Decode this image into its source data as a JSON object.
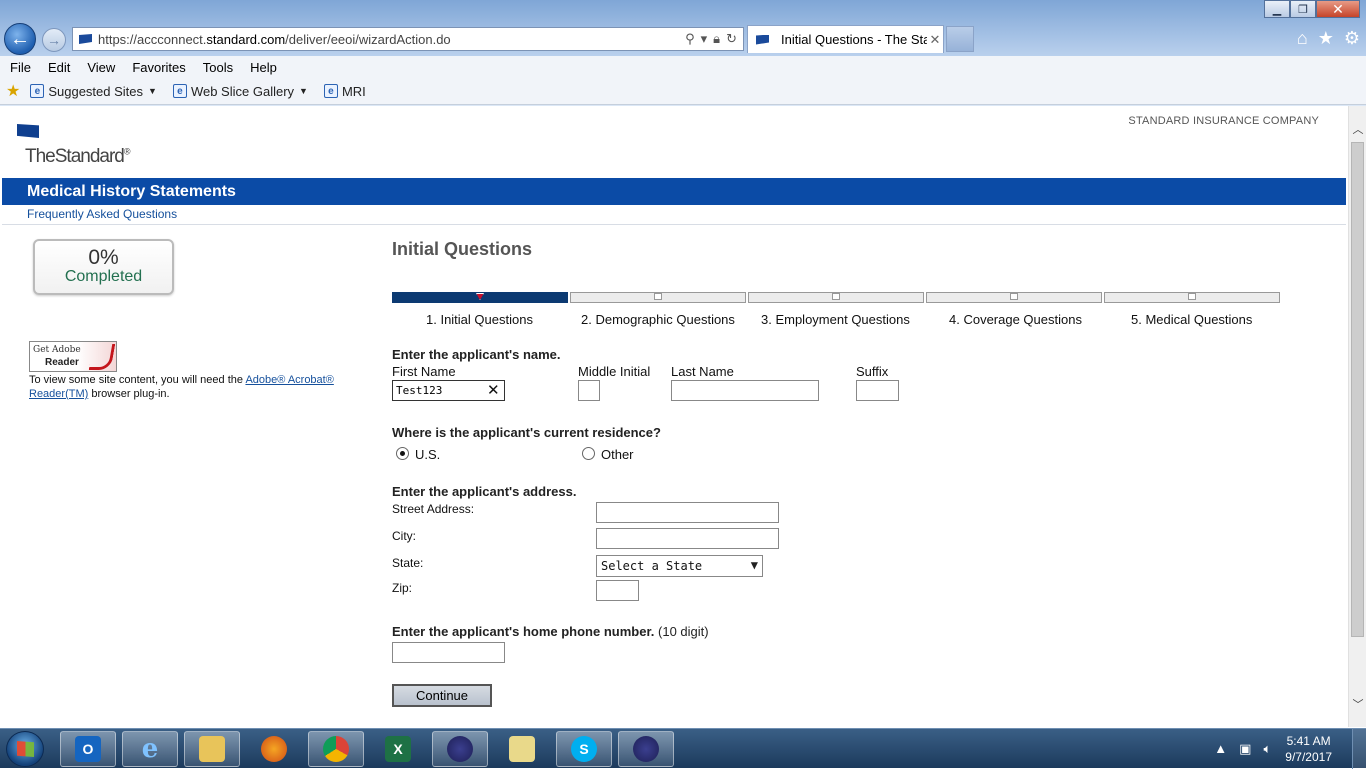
{
  "browser": {
    "url_prefix": "https://accconnect.",
    "url_domain": "standard.com",
    "url_suffix": "/deliver/eeoi/wizardAction.do",
    "tab_title": "Initial Questions - The Stan...",
    "menu": [
      "File",
      "Edit",
      "View",
      "Favorites",
      "Tools",
      "Help"
    ],
    "favorites": [
      {
        "label": "Suggested Sites"
      },
      {
        "label": "Web Slice Gallery"
      },
      {
        "label": "MRI"
      }
    ]
  },
  "site": {
    "brand": "TheStandard",
    "brand_mark": "®",
    "company": "STANDARD INSURANCE COMPANY",
    "header_title": "Medical History Statements",
    "faq_link": "Frequently Asked Questions"
  },
  "progress": {
    "percent_label": "0%",
    "completed_label": "Completed",
    "percent": 0
  },
  "adobe": {
    "badge_get": "Get Adobe",
    "badge_reader": "Reader",
    "text_before": "To view some site content, you will need the ",
    "link": "Adobe® Acrobat® Reader(TM)",
    "text_after": " browser plug-in."
  },
  "wizard": {
    "heading": "Initial Questions",
    "steps": [
      {
        "label": "1. Initial Questions",
        "active": true
      },
      {
        "label": "2. Demographic Questions",
        "active": false
      },
      {
        "label": "3. Employment Questions",
        "active": false
      },
      {
        "label": "4. Coverage Questions",
        "active": false
      },
      {
        "label": "5. Medical Questions",
        "active": false
      }
    ]
  },
  "form": {
    "name_question": "Enter the applicant's name.",
    "first_name_label": "First Name",
    "first_name_value": "Test123",
    "middle_initial_label": "Middle Initial",
    "middle_initial_value": "",
    "last_name_label": "Last Name",
    "last_name_value": "",
    "suffix_label": "Suffix",
    "suffix_value": "",
    "residence_question": "Where is the applicant's current residence?",
    "residence_options": [
      {
        "label": "U.S.",
        "checked": true
      },
      {
        "label": "Other",
        "checked": false
      }
    ],
    "address_question": "Enter the applicant's address.",
    "street_label": "Street Address:",
    "street_value": "",
    "city_label": "City:",
    "city_value": "",
    "state_label": "State:",
    "state_selected": "Select a State",
    "zip_label": "Zip:",
    "zip_value": "",
    "phone_question": "Enter the applicant's home phone number.",
    "phone_hint": "(10 digit)",
    "phone_value": "",
    "continue_label": "Continue"
  },
  "taskbar": {
    "apps": [
      "outlook",
      "internet-explorer",
      "file-explorer",
      "firefox",
      "chrome",
      "excel",
      "eclipse",
      "notes",
      "skype",
      "eclipse"
    ],
    "time": "5:41 AM",
    "date": "9/7/2017"
  }
}
